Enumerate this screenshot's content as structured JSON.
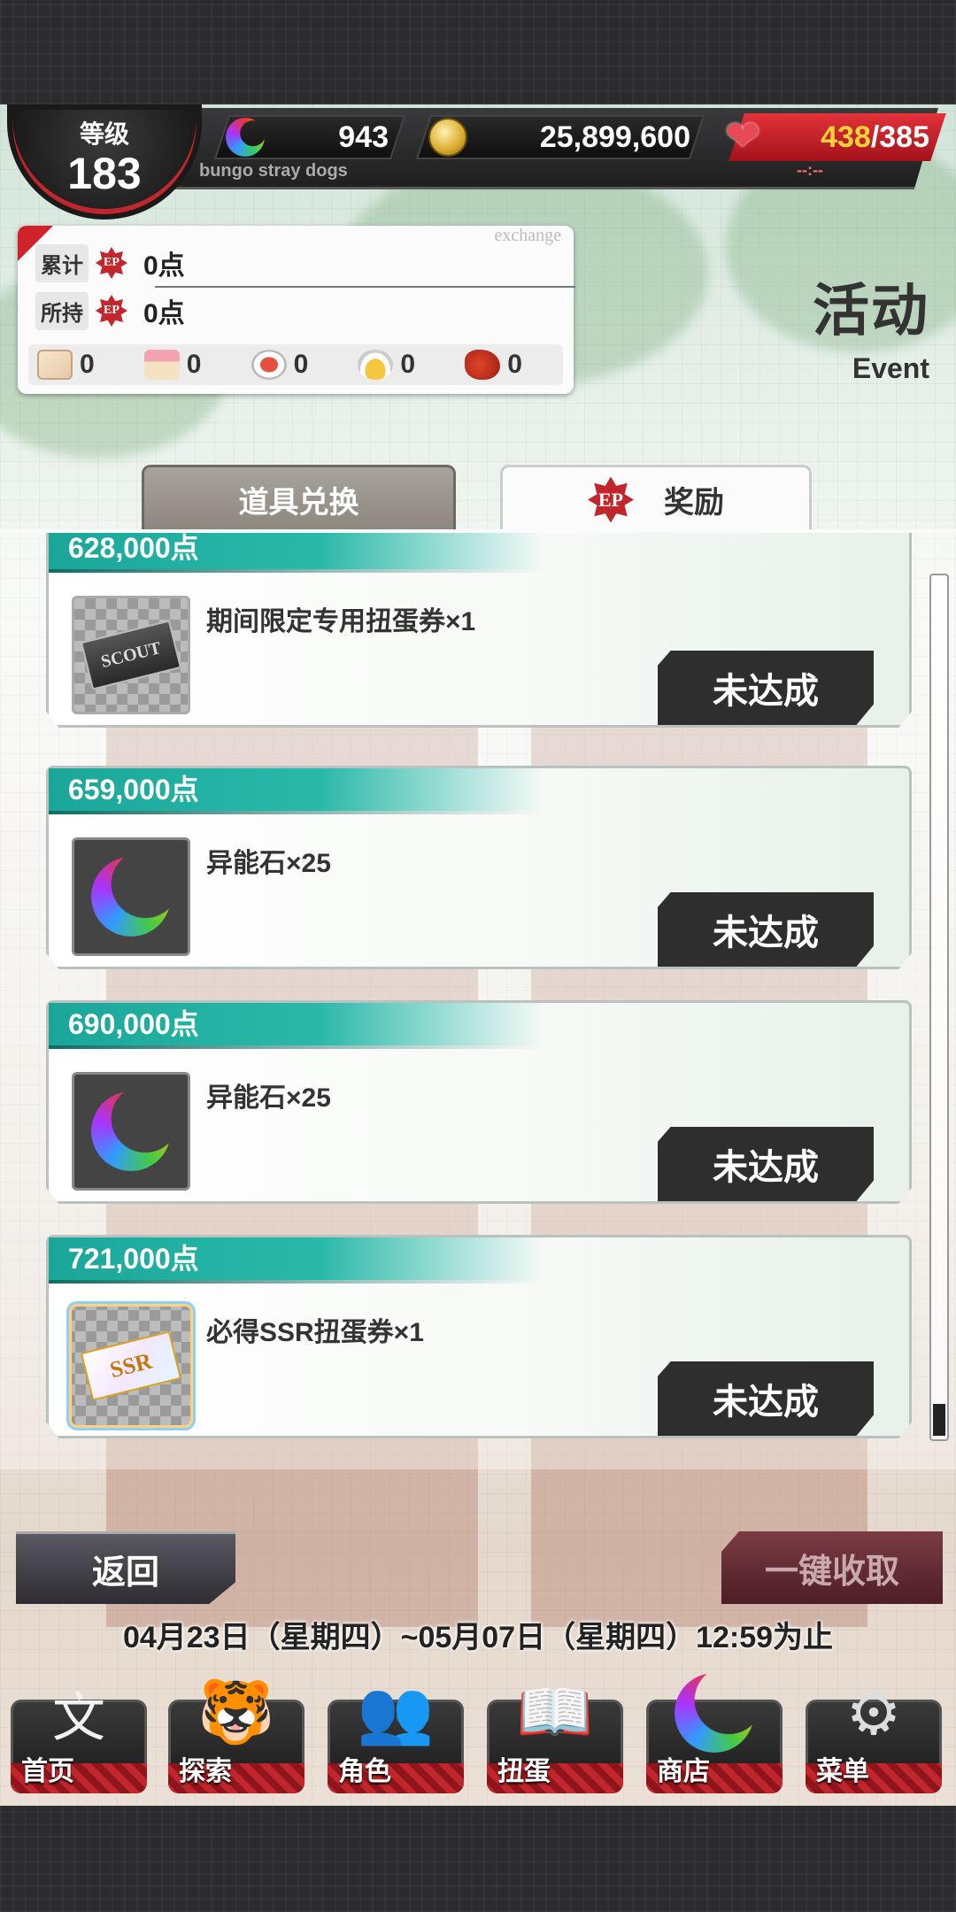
{
  "header": {
    "level_label": "等级",
    "level": "183",
    "gems": "943",
    "coins": "25,899,600",
    "ap_current": "438",
    "ap_max": "/385",
    "ap_timer": "--:--",
    "sub_label": "bungo stray dogs"
  },
  "points_panel": {
    "exchange_label": "exchange",
    "total_label": "累计",
    "total_value": "0点",
    "owned_label": "所持",
    "owned_value": "0点",
    "ep_text": "EP",
    "items": [
      {
        "icon": "letter-icon",
        "value": "0"
      },
      {
        "icon": "cake-icon",
        "value": "0"
      },
      {
        "icon": "sushi-icon",
        "value": "0"
      },
      {
        "icon": "pineapple-dish-icon",
        "value": "0"
      },
      {
        "icon": "lobster-icon",
        "value": "0"
      }
    ]
  },
  "event": {
    "title_cn": "活动",
    "title_en": "Event"
  },
  "tabs": {
    "exchange": "道具兑换",
    "reward": "奖励"
  },
  "rewards": [
    {
      "points": "628,000点",
      "item": "期间限定专用扭蛋券×1",
      "status": "未达成",
      "icon": "scout-ticket-icon",
      "ticket_text": "SCOUT"
    },
    {
      "points": "659,000点",
      "item": "异能石×25",
      "status": "未达成",
      "icon": "ability-stone-icon"
    },
    {
      "points": "690,000点",
      "item": "异能石×25",
      "status": "未达成",
      "icon": "ability-stone-icon"
    },
    {
      "points": "721,000点",
      "item": "必得SSR扭蛋券×1",
      "status": "未达成",
      "icon": "ssr-ticket-icon",
      "ticket_text": "SSR"
    }
  ],
  "controls": {
    "back": "返回",
    "collect_all": "一键收取",
    "period": "04月23日（星期四）~05月07日（星期四）12:59为止"
  },
  "nav": [
    {
      "label": "首页",
      "icon": "bungo-logo-icon"
    },
    {
      "label": "探索",
      "icon": "tiger-icon"
    },
    {
      "label": "角色",
      "icon": "people-icon"
    },
    {
      "label": "扭蛋",
      "icon": "book-icon"
    },
    {
      "label": "商店",
      "icon": "moon-stone-icon"
    },
    {
      "label": "菜单",
      "icon": "gear-icon"
    }
  ],
  "colors": {
    "accent_red": "#c0262c",
    "teal_strip": "#1aa79a",
    "ap_red": "#e3323a"
  }
}
